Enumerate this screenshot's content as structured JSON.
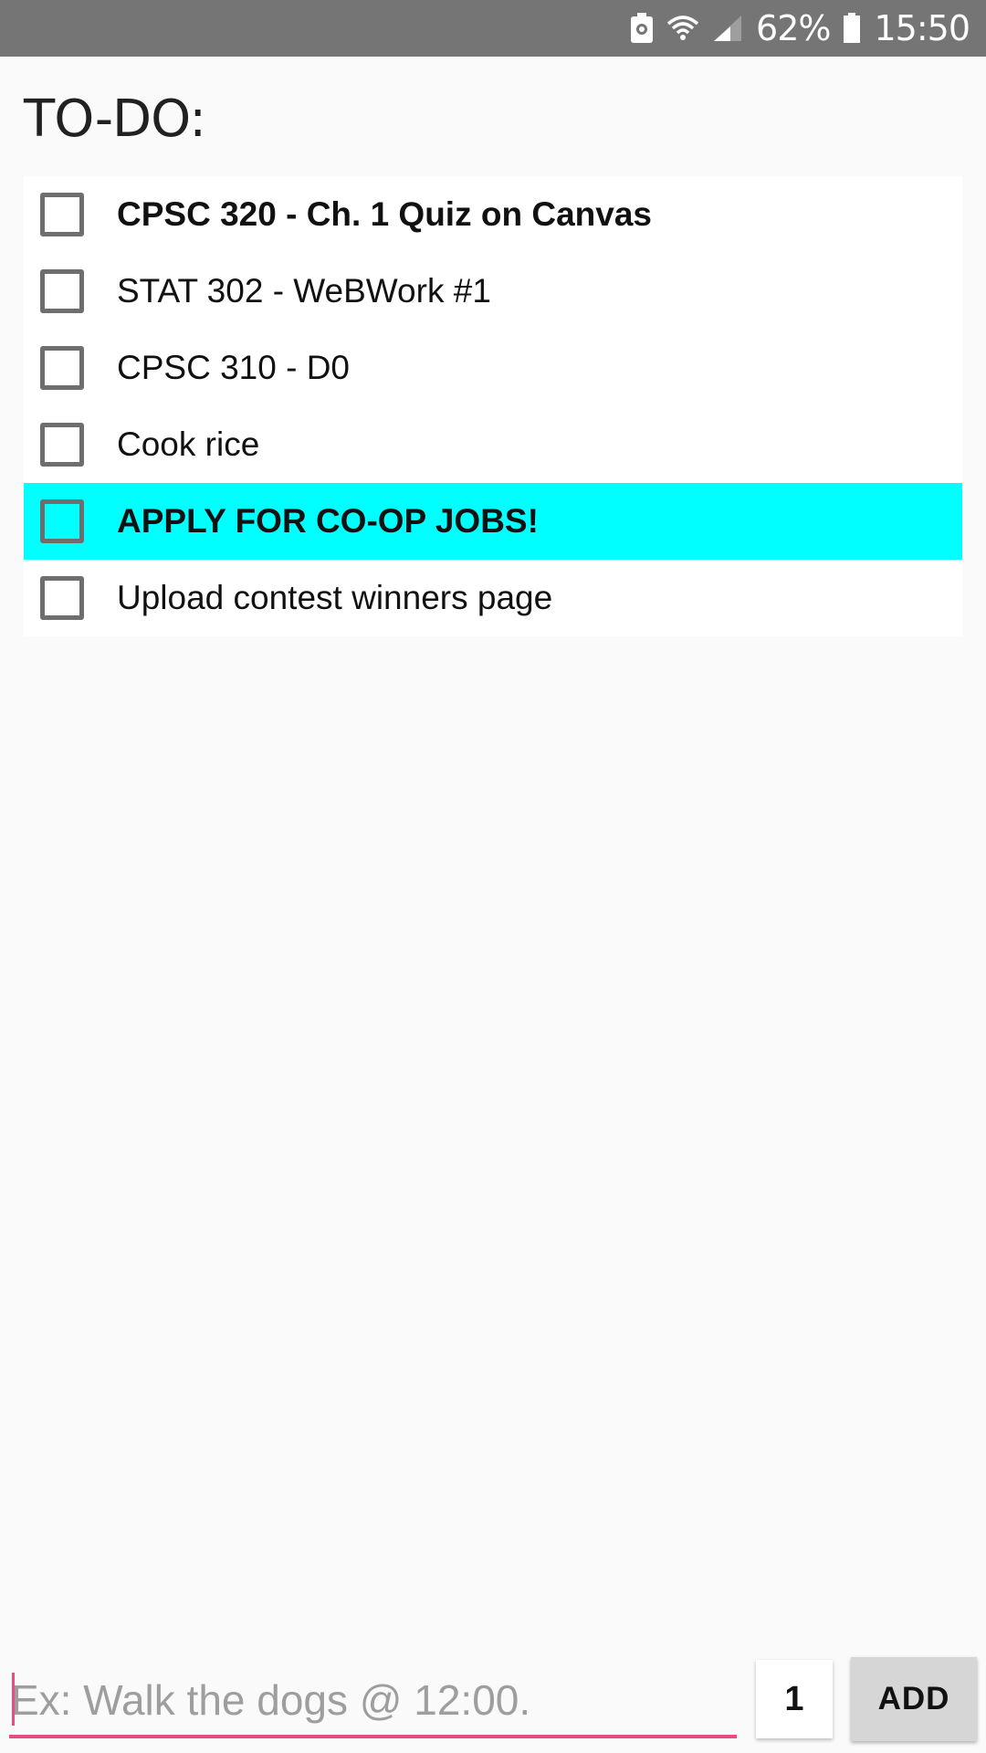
{
  "status_bar": {
    "battery_percent": "62%",
    "time": "15:50",
    "icons": [
      "notification-battery-icon",
      "wifi-icon",
      "cellular-signal-icon",
      "battery-icon"
    ]
  },
  "page": {
    "title": "TO-DO:"
  },
  "todos": [
    {
      "text": "CPSC 320 - Ch. 1 Quiz on Canvas",
      "bold": true,
      "highlight": false,
      "checked": false
    },
    {
      "text": "STAT 302 - WeBWork #1",
      "bold": false,
      "highlight": false,
      "checked": false
    },
    {
      "text": "CPSC 310 - D0",
      "bold": false,
      "highlight": false,
      "checked": false
    },
    {
      "text": "Cook rice",
      "bold": false,
      "highlight": false,
      "checked": false
    },
    {
      "text": "APPLY FOR CO-OP JOBS!",
      "bold": true,
      "highlight": true,
      "checked": false
    },
    {
      "text": "Upload contest winners page",
      "bold": false,
      "highlight": false,
      "checked": false
    }
  ],
  "colors": {
    "highlight": "#00ffff",
    "accent": "#e84b81",
    "status_bar": "#757575"
  },
  "input_bar": {
    "task_placeholder": "Ex: Walk the dogs @ 12:00.",
    "task_value": "",
    "count_value": "1",
    "add_label": "ADD"
  }
}
